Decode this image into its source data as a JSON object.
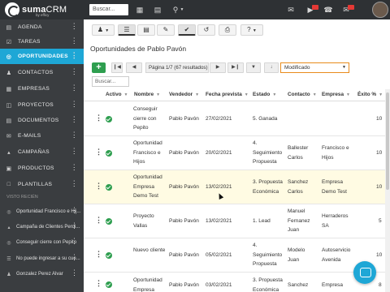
{
  "app": {
    "brand": "suma",
    "brand_suffix": "CRM",
    "tagline": "by efficy",
    "search_placeholder": "Buscar...",
    "accent": "#1ea7d6",
    "success": "#2e9e4f"
  },
  "topbar_icons": [
    "building-icon",
    "calendar-icon",
    "search-icon",
    "mail-icon",
    "video-icon",
    "phone-icon",
    "envelope-icon"
  ],
  "sidebar": {
    "items": [
      {
        "label": "AGENDA",
        "icon": "calendar-icon"
      },
      {
        "label": "TAREAS",
        "icon": "check-icon"
      },
      {
        "label": "OPORTUNIDADES",
        "icon": "target-icon",
        "active": true
      },
      {
        "label": "CONTACTOS",
        "icon": "user-icon"
      },
      {
        "label": "EMPRESAS",
        "icon": "building-icon"
      },
      {
        "label": "PROYECTOS",
        "icon": "folder-icon"
      },
      {
        "label": "DOCUMENTOS",
        "icon": "document-icon"
      },
      {
        "label": "E-MAILS",
        "icon": "mail-icon"
      },
      {
        "label": "CAMPAÑAS",
        "icon": "megaphone-icon"
      },
      {
        "label": "PRODUCTOS",
        "icon": "box-icon"
      },
      {
        "label": "PLANTILLAS",
        "icon": "template-icon"
      }
    ],
    "recent_heading": "VISTO RECIÉN",
    "recent": [
      "Oportunidad Francisco e Hij...",
      "Campaña de Clientes Perdi...",
      "Conseguir cierre con Pepito",
      "No puede ingresar a su cue...",
      "Gonzalez Perez Alvar"
    ]
  },
  "main": {
    "title": "Oportunidades de Pablo Pavón",
    "pagination": "Página 1/7 (67 resultados)",
    "sort_value": "Modificado",
    "search_placeholder": "Buscar...",
    "columns": [
      "Activo",
      "Nombre",
      "Vendedor",
      "Fecha prevista",
      "Estado",
      "Contacto",
      "Empresa",
      "Éxito %"
    ],
    "rows": [
      {
        "nombre": "Conseguir cierre con Pepito",
        "vendedor": "Pablo Pavón",
        "fecha": "27/02/2021",
        "estado": "5. Ganada",
        "contacto": "",
        "empresa": "",
        "exito": "10"
      },
      {
        "nombre": "Oportunidad Francisco e Hijos",
        "vendedor": "Pablo Pavón",
        "fecha": "20/02/2021",
        "estado": "4. Seguimiento Propuesta",
        "contacto": "Ballester Carlos",
        "empresa": "Francisco e Hijos",
        "exito": "10"
      },
      {
        "nombre": "Oportunidad Empresa Demo Test",
        "vendedor": "Pablo Pavón",
        "fecha": "13/02/2021",
        "estado": "3. Propuesta Económica",
        "contacto": "Sanchez Carlos",
        "empresa": "Empresa Demo Test",
        "exito": "10",
        "highlight": true
      },
      {
        "nombre": "Proyecto Vallas",
        "vendedor": "Pablo Pavón",
        "fecha": "13/02/2021",
        "estado": "1. Lead",
        "contacto": "Manuel Fernanez Juan",
        "empresa": "Herraderos SA",
        "exito": "5"
      },
      {
        "nombre": "Nuevo cliente",
        "vendedor": "Pablo Pavón",
        "fecha": "05/02/2021",
        "estado": "4. Seguimiento Propuesta",
        "contacto": "Modelo Juan",
        "empresa": "Autoservicio Avenida",
        "exito": "10"
      },
      {
        "nombre": "Oportunidad Empresa",
        "vendedor": "Pablo Pavón",
        "fecha": "03/02/2021",
        "estado": "3. Propuesta Económica",
        "contacto": "Sanchez",
        "empresa": "Empresa",
        "exito": "8"
      }
    ]
  }
}
